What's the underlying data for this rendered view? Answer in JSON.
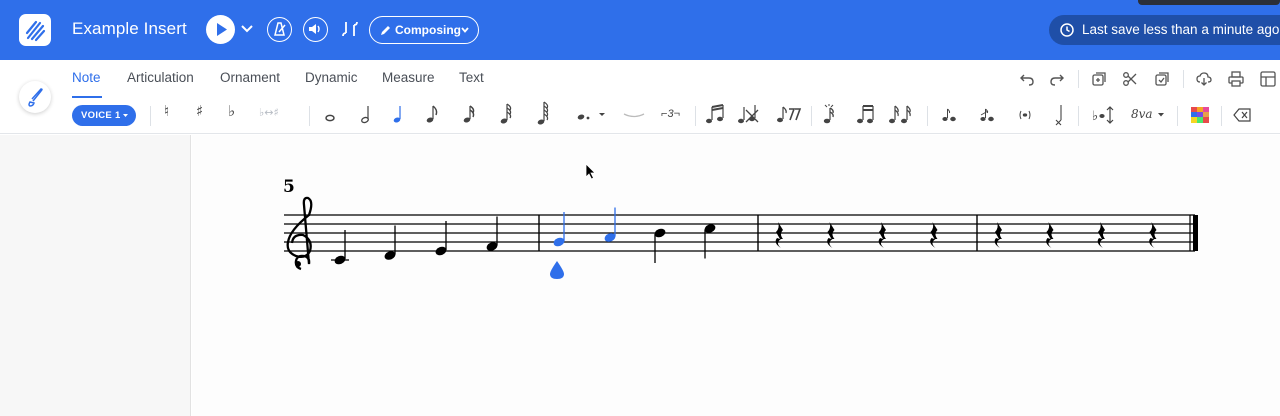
{
  "header": {
    "app_title": "Example Insert",
    "mode_label": "Composing",
    "save_status": "Last save less than a minute ago"
  },
  "tabs": [
    {
      "label": "Note",
      "active": true
    },
    {
      "label": "Articulation",
      "active": false
    },
    {
      "label": "Ornament",
      "active": false
    },
    {
      "label": "Dynamic",
      "active": false
    },
    {
      "label": "Measure",
      "active": false
    },
    {
      "label": "Text",
      "active": false
    }
  ],
  "toolbar": {
    "voice_label": "VOICE 1",
    "tuplet_label": "3",
    "ottava_label": "8va"
  },
  "score": {
    "measure_number": "5",
    "clef": "treble",
    "notes": [
      {
        "pitch": "C4",
        "duration": "quarter",
        "selected": false
      },
      {
        "pitch": "D4",
        "duration": "quarter",
        "selected": false
      },
      {
        "pitch": "E4",
        "duration": "quarter",
        "selected": false
      },
      {
        "pitch": "F4",
        "duration": "quarter",
        "selected": false
      },
      {
        "pitch": "G4",
        "duration": "quarter",
        "selected": true
      },
      {
        "pitch": "A4",
        "duration": "quarter",
        "selected": true
      },
      {
        "pitch": "B4",
        "duration": "quarter",
        "selected": false
      },
      {
        "pitch": "C5",
        "duration": "quarter",
        "selected": false
      }
    ],
    "rest_measures": 2,
    "rests_per_measure": 4
  },
  "colors": {
    "brand": "#2f6fea",
    "save_pill": "#1f4fa8",
    "selected_note": "#2f6fea"
  },
  "icons": [
    "logo-icon",
    "play-icon",
    "metronome-icon",
    "speaker-icon",
    "tuning-icon",
    "pencil-icon",
    "history-icon",
    "undo-icon",
    "redo-icon",
    "add-measure-icon",
    "scissors-icon",
    "paste-icon",
    "download-icon",
    "print-icon",
    "layout-icon",
    "brush-icon",
    "delete-icon"
  ]
}
